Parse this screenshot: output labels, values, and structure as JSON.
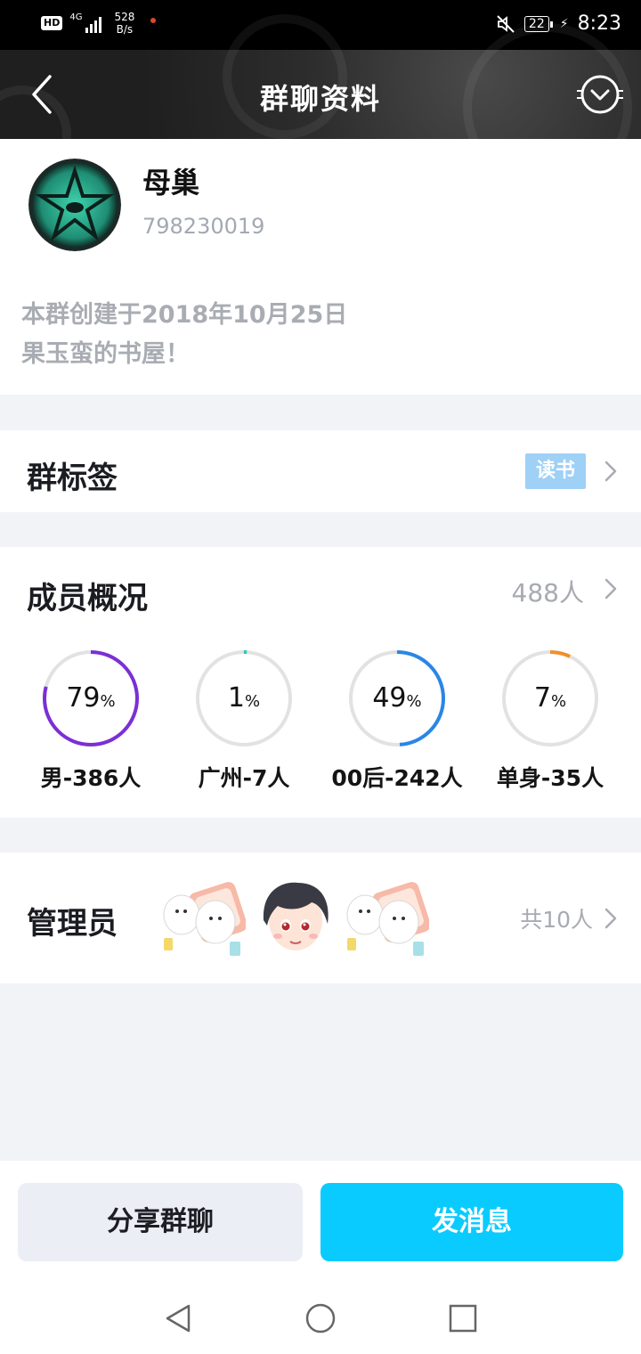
{
  "status_bar": {
    "hd": "HD",
    "network": "4G",
    "speed_value": "528",
    "speed_unit": "B/s",
    "battery": "22",
    "time": "8:23"
  },
  "header": {
    "title": "群聊资料"
  },
  "group": {
    "name": "母巢",
    "id": "798230019",
    "intro_line1": "本群创建于2018年10月25日",
    "intro_line2": "果玉蛮的书屋！"
  },
  "tags": {
    "label": "群标签",
    "tag": "读书"
  },
  "members": {
    "label": "成员概况",
    "count": "488人",
    "stats": [
      {
        "percent": 79,
        "pct_text": "79",
        "label": "男-386人",
        "color": "#7b2fd6"
      },
      {
        "percent": 1,
        "pct_text": "1",
        "label": "广州-7人",
        "color": "#2cc6c0"
      },
      {
        "percent": 49,
        "pct_text": "49",
        "label": "00后-242人",
        "color": "#2a86e6"
      },
      {
        "percent": 7,
        "pct_text": "7",
        "label": "单身-35人",
        "color": "#f0902a"
      }
    ],
    "pct_unit": "%"
  },
  "admins": {
    "label": "管理员",
    "count": "共10人"
  },
  "actions": {
    "share": "分享群聊",
    "send": "发消息"
  },
  "colors": {
    "accent": "#0acbff",
    "tag_bg": "#9fd0f6"
  }
}
